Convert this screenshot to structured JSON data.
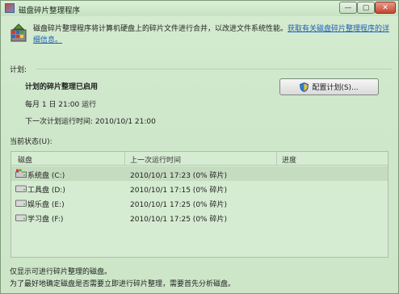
{
  "window": {
    "title": "磁盘碎片整理程序",
    "min_glyph": "—",
    "max_glyph": "▢",
    "close_glyph": "✕"
  },
  "header": {
    "description": "磁盘碎片整理程序将计算机硬盘上的碎片文件进行合并，以改进文件系统性能。",
    "link": "获取有关磁盘碎片整理程序的详细信息。"
  },
  "schedule": {
    "section_label": "计划:",
    "status": "计划的碎片整理已启用",
    "frequency": "每月 1 日 21:00 运行",
    "next_run": "下一次计划运行时间: 2010/10/1 21:00",
    "configure_button": "配置计划(S)..."
  },
  "current_status": {
    "section_label": "当前状态(U):",
    "columns": {
      "disk": "磁盘",
      "last_run": "上一次运行时间",
      "progress": "进度"
    },
    "rows": [
      {
        "name": "系统盘 (C:)",
        "last_run": "2010/10/1 17:23 (0% 碎片)",
        "icon": "system-drive-icon",
        "selected": true
      },
      {
        "name": "工具盘 (D:)",
        "last_run": "2010/10/1 17:15 (0% 碎片)",
        "icon": "drive-icon",
        "selected": false
      },
      {
        "name": "娱乐盘 (E:)",
        "last_run": "2010/10/1 17:25 (0% 碎片)",
        "icon": "drive-icon",
        "selected": false
      },
      {
        "name": "学习盘 (F:)",
        "last_run": "2010/10/1 17:25 (0% 碎片)",
        "icon": "drive-icon",
        "selected": false
      }
    ]
  },
  "footer": {
    "line1": "仅显示可进行碎片整理的磁盘。",
    "line2": "为了最好地确定磁盘是否需要立即进行碎片整理，需要首先分析磁盘。"
  },
  "colors": {
    "link": "#1f5fb5",
    "close_button": "#c4472f",
    "background": "#cfe7cb"
  }
}
